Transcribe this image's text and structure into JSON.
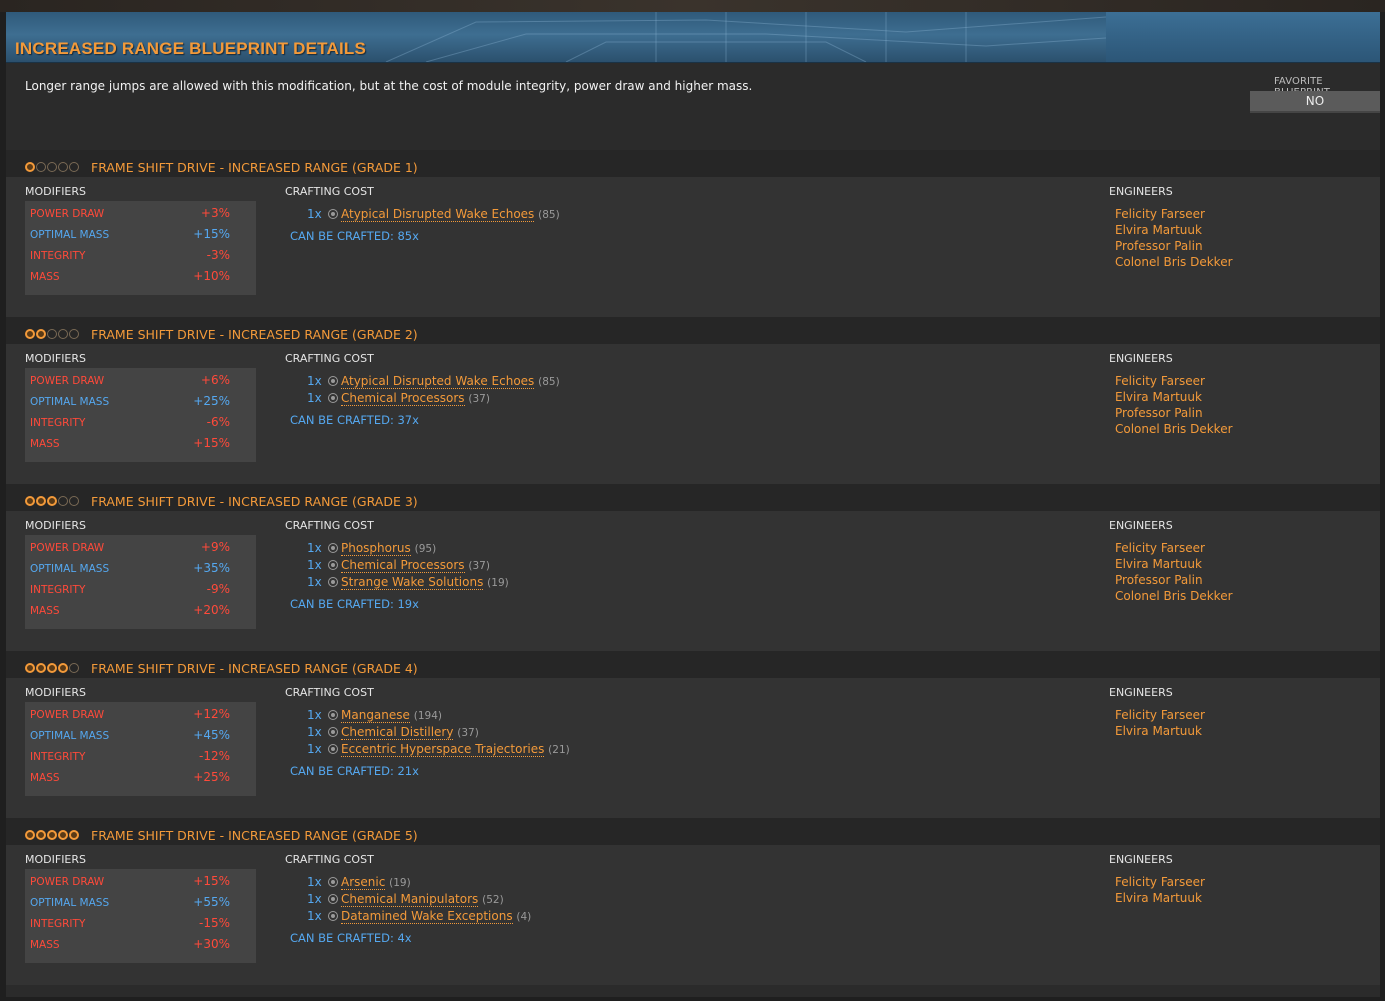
{
  "header": {
    "title": "INCREASED RANGE BLUEPRINT DETAILS"
  },
  "description": "Longer range jumps are allowed with this modification, but at the cost of module integrity, power draw and higher mass.",
  "favorite": {
    "label": "FAVORITE BLUEPRINT",
    "value": "NO"
  },
  "labels": {
    "modifiers": "MODIFIERS",
    "crafting_cost": "CRAFTING COST",
    "engineers": "ENGINEERS"
  },
  "colors": {
    "accent": "#f39a3a",
    "positive": "#55a8f0",
    "negative": "#ff4a3a"
  },
  "grades": [
    {
      "stars": 1,
      "title": "FRAME SHIFT DRIVE - INCREASED RANGE (GRADE 1)",
      "modifiers": [
        {
          "name": "POWER DRAW",
          "value": "+3%",
          "tone": "red"
        },
        {
          "name": "OPTIMAL MASS",
          "value": "+15%",
          "tone": "blue"
        },
        {
          "name": "INTEGRITY",
          "value": "-3%",
          "tone": "red"
        },
        {
          "name": "MASS",
          "value": "+10%",
          "tone": "red"
        }
      ],
      "cost": [
        {
          "qty": "1x",
          "name": "Atypical Disrupted Wake Echoes",
          "count": "(85)"
        }
      ],
      "can_be_crafted": "CAN BE CRAFTED: 85x",
      "engineers": [
        "Felicity Farseer",
        "Elvira Martuuk",
        "Professor Palin",
        "Colonel Bris Dekker"
      ]
    },
    {
      "stars": 2,
      "title": "FRAME SHIFT DRIVE - INCREASED RANGE (GRADE 2)",
      "modifiers": [
        {
          "name": "POWER DRAW",
          "value": "+6%",
          "tone": "red"
        },
        {
          "name": "OPTIMAL MASS",
          "value": "+25%",
          "tone": "blue"
        },
        {
          "name": "INTEGRITY",
          "value": "-6%",
          "tone": "red"
        },
        {
          "name": "MASS",
          "value": "+15%",
          "tone": "red"
        }
      ],
      "cost": [
        {
          "qty": "1x",
          "name": "Atypical Disrupted Wake Echoes",
          "count": "(85)"
        },
        {
          "qty": "1x",
          "name": "Chemical Processors",
          "count": "(37)"
        }
      ],
      "can_be_crafted": "CAN BE CRAFTED: 37x",
      "engineers": [
        "Felicity Farseer",
        "Elvira Martuuk",
        "Professor Palin",
        "Colonel Bris Dekker"
      ]
    },
    {
      "stars": 3,
      "title": "FRAME SHIFT DRIVE - INCREASED RANGE (GRADE 3)",
      "modifiers": [
        {
          "name": "POWER DRAW",
          "value": "+9%",
          "tone": "red"
        },
        {
          "name": "OPTIMAL MASS",
          "value": "+35%",
          "tone": "blue"
        },
        {
          "name": "INTEGRITY",
          "value": "-9%",
          "tone": "red"
        },
        {
          "name": "MASS",
          "value": "+20%",
          "tone": "red"
        }
      ],
      "cost": [
        {
          "qty": "1x",
          "name": "Phosphorus",
          "count": "(95)"
        },
        {
          "qty": "1x",
          "name": "Chemical Processors",
          "count": "(37)"
        },
        {
          "qty": "1x",
          "name": "Strange Wake Solutions",
          "count": "(19)"
        }
      ],
      "can_be_crafted": "CAN BE CRAFTED: 19x",
      "engineers": [
        "Felicity Farseer",
        "Elvira Martuuk",
        "Professor Palin",
        "Colonel Bris Dekker"
      ]
    },
    {
      "stars": 4,
      "title": "FRAME SHIFT DRIVE - INCREASED RANGE (GRADE 4)",
      "modifiers": [
        {
          "name": "POWER DRAW",
          "value": "+12%",
          "tone": "red"
        },
        {
          "name": "OPTIMAL MASS",
          "value": "+45%",
          "tone": "blue"
        },
        {
          "name": "INTEGRITY",
          "value": "-12%",
          "tone": "red"
        },
        {
          "name": "MASS",
          "value": "+25%",
          "tone": "red"
        }
      ],
      "cost": [
        {
          "qty": "1x",
          "name": "Manganese",
          "count": "(194)"
        },
        {
          "qty": "1x",
          "name": "Chemical Distillery",
          "count": "(37)"
        },
        {
          "qty": "1x",
          "name": "Eccentric Hyperspace Trajectories",
          "count": "(21)"
        }
      ],
      "can_be_crafted": "CAN BE CRAFTED: 21x",
      "engineers": [
        "Felicity Farseer",
        "Elvira Martuuk"
      ]
    },
    {
      "stars": 5,
      "title": "FRAME SHIFT DRIVE - INCREASED RANGE (GRADE 5)",
      "modifiers": [
        {
          "name": "POWER DRAW",
          "value": "+15%",
          "tone": "red"
        },
        {
          "name": "OPTIMAL MASS",
          "value": "+55%",
          "tone": "blue"
        },
        {
          "name": "INTEGRITY",
          "value": "-15%",
          "tone": "red"
        },
        {
          "name": "MASS",
          "value": "+30%",
          "tone": "red"
        }
      ],
      "cost": [
        {
          "qty": "1x",
          "name": "Arsenic",
          "count": "(19)"
        },
        {
          "qty": "1x",
          "name": "Chemical Manipulators",
          "count": "(52)"
        },
        {
          "qty": "1x",
          "name": "Datamined Wake Exceptions",
          "count": "(4)"
        }
      ],
      "can_be_crafted": "CAN BE CRAFTED: 4x",
      "engineers": [
        "Felicity Farseer",
        "Elvira Martuuk"
      ]
    }
  ]
}
